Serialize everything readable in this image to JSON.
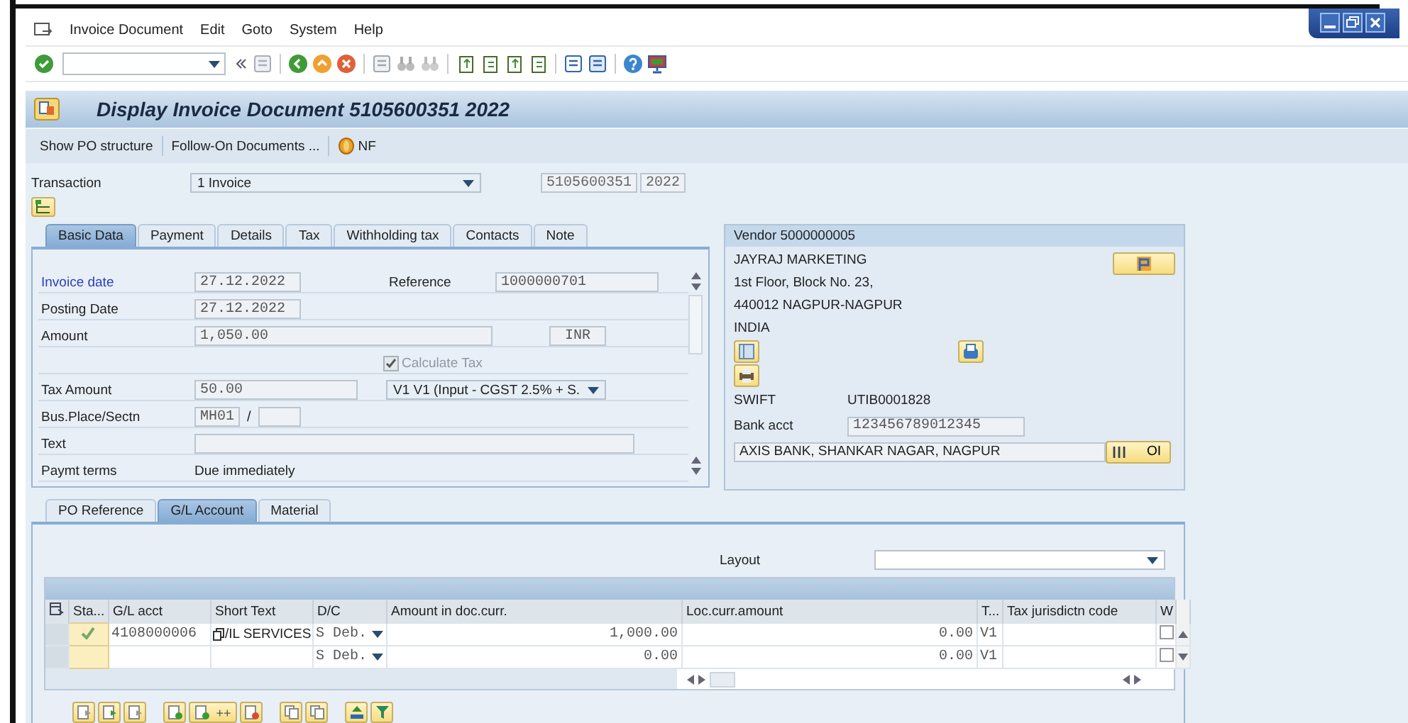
{
  "menu_bar": [
    "Invoice Document",
    "Edit",
    "Goto",
    "System",
    "Help"
  ],
  "title": "Display Invoice Document 5105600351 2022",
  "app_toolbar": [
    {
      "label": "Show PO structure"
    },
    {
      "label": "Follow-On Documents ..."
    },
    {
      "label": "NF"
    }
  ],
  "transaction": {
    "label": "Transaction",
    "value": "1 Invoice",
    "document_number": "5105600351",
    "fiscal_year": "2022"
  },
  "header_tabs": [
    {
      "label": "Basic Data",
      "selected": true
    },
    {
      "label": "Payment",
      "selected": false
    },
    {
      "label": "Details",
      "selected": false
    },
    {
      "label": "Tax",
      "selected": false
    },
    {
      "label": "Withholding tax",
      "selected": false
    },
    {
      "label": "Contacts",
      "selected": false
    },
    {
      "label": "Note",
      "selected": false
    }
  ],
  "basic_data": {
    "invoice_date": {
      "label": "Invoice date",
      "value": "27.12.2022"
    },
    "reference": {
      "label": "Reference",
      "value": "1000000701"
    },
    "posting_date": {
      "label": "Posting Date",
      "value": "27.12.2022"
    },
    "amount": {
      "label": "Amount",
      "value": "1,050.00",
      "currency": "INR"
    },
    "calculate_tax": {
      "label": "Calculate Tax",
      "checked": true,
      "disabled": true
    },
    "tax_amount": {
      "label": "Tax Amount",
      "value": "50.00"
    },
    "tax_code": {
      "value": "V1 V1 (Input - CGST 2.5% + S."
    },
    "business_place": {
      "label": "Bus.Place/Sectn",
      "value": "MH01",
      "separator": "/"
    },
    "text": {
      "label": "Text"
    },
    "payment_terms": {
      "label": "Paymt terms",
      "value": "Due immediately"
    }
  },
  "vendor": {
    "title": "Vendor 5000000005",
    "address": [
      "JAYRAJ MARKETING",
      "1st Floor, Block No. 23,",
      "440012 NAGPUR-NAGPUR",
      "INDIA"
    ],
    "swift": {
      "label": "SWIFT",
      "value": "UTIB0001828"
    },
    "bank_account": {
      "label": "Bank acct",
      "value": "123456789012345"
    },
    "bank_name": "AXIS BANK, SHANKAR NAGAR, NAGPUR",
    "oi_button": "OI"
  },
  "item_tabs": [
    {
      "label": "PO Reference",
      "selected": false
    },
    {
      "label": "G/L Account",
      "selected": true
    },
    {
      "label": "Material",
      "selected": false
    }
  ],
  "layout": {
    "label": "Layout"
  },
  "table": {
    "columns": [
      "Sta...",
      "G/L acct",
      "Short Text",
      "D/C",
      "Amount in doc.curr.",
      "Loc.curr.amount",
      "T...",
      "Tax jurisdictn code",
      "W"
    ],
    "rows": [
      {
        "status_ok": true,
        "gl_account": "4108000006",
        "short_text": "/IL SERVICES",
        "debit_credit": "S Deb.",
        "amount_doc": "1,000.00",
        "amount_local": "0.00",
        "tax_code": "V1",
        "w_checked": false
      },
      {
        "status_ok": false,
        "gl_account": "",
        "short_text": "",
        "debit_credit": "S Deb.",
        "amount_doc": "0.00",
        "amount_local": "0.00",
        "tax_code": "V1",
        "w_checked": false
      }
    ]
  },
  "table_toolbar_label": "++"
}
